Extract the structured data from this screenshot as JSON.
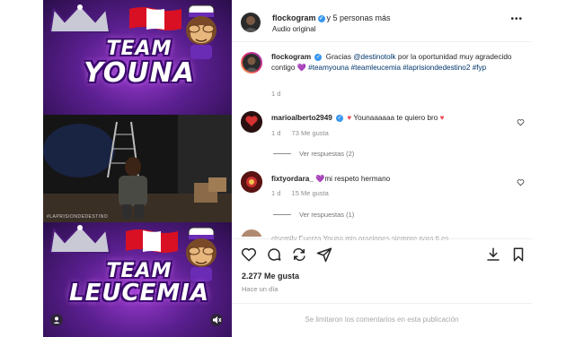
{
  "header": {
    "username": "flockogram",
    "collab_text": "y 5 personas más",
    "audio": "Audio original",
    "more_icon": "more-horizontal-icon"
  },
  "caption": {
    "username": "flockogram",
    "text_1": "Gracias ",
    "mention": "@destinotolk",
    "text_2": " por la oportunidad muy agradecido contigo ",
    "emoji": "💜",
    "hashtags": "#teamyouna #teamleucemia #laprisiondedestino2 #fyp",
    "time": "1 d"
  },
  "comments": [
    {
      "username": "marioalberto2949",
      "verified": true,
      "text_pre_heart": "Younaaaaaa te quiero bro",
      "time": "1 d",
      "likes": "73 Me gusta",
      "replies": "Ver respuestas (2)"
    },
    {
      "username": "fixtyordara_",
      "verified": false,
      "emoji": "💜",
      "text": "mi respeto hermano",
      "time": "1 d",
      "likes": "15 Me gusta",
      "replies": "Ver respuestas (1)"
    }
  ],
  "cutoff_comment": "clsemily Fuerza Youna mis oraciones siempre para ti es",
  "footer": {
    "likes": "2.277 Me gusta",
    "time": "Hace un día",
    "comments_limited": "Se limitaron los comentarios en esta publicación"
  },
  "media": {
    "top_line1": "TEAM",
    "top_line2": "YOUNA",
    "bottom_line1": "TEAM",
    "bottom_line2": "LEUCEMIA",
    "watermark": "#LAPRISIONDEDESTINO"
  },
  "icons": {
    "like": "heart-icon",
    "comment": "comment-icon",
    "share": "share-icon",
    "send": "send-icon",
    "download": "download-icon",
    "save": "bookmark-icon"
  },
  "colors": {
    "link": "#00376b",
    "verified": "#3897f0",
    "heart_red": "#ed4956",
    "purple": "#7b2fbf"
  }
}
